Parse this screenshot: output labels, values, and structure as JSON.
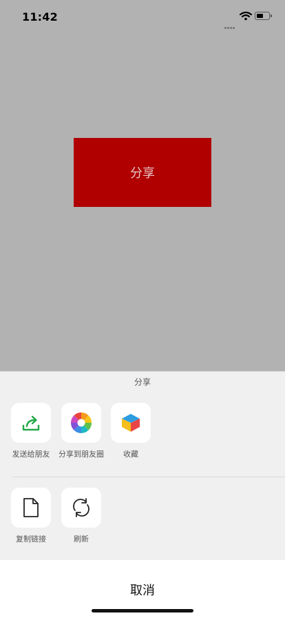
{
  "status_bar": {
    "time": "11:42"
  },
  "main": {
    "share_button_label": "分享"
  },
  "share_sheet": {
    "title": "分享",
    "row1": [
      {
        "label": "发送给朋友",
        "icon": "share-forward-icon"
      },
      {
        "label": "分享到朋友圈",
        "icon": "moments-aperture-icon"
      },
      {
        "label": "收藏",
        "icon": "favorites-cube-icon"
      }
    ],
    "row2": [
      {
        "label": "复制链接",
        "icon": "document-icon"
      },
      {
        "label": "刷新",
        "icon": "refresh-icon"
      }
    ],
    "cancel_label": "取消"
  },
  "colors": {
    "background_dim": "#b2b2b2",
    "share_button": "#b00000",
    "forward_icon": "#22a84a"
  }
}
